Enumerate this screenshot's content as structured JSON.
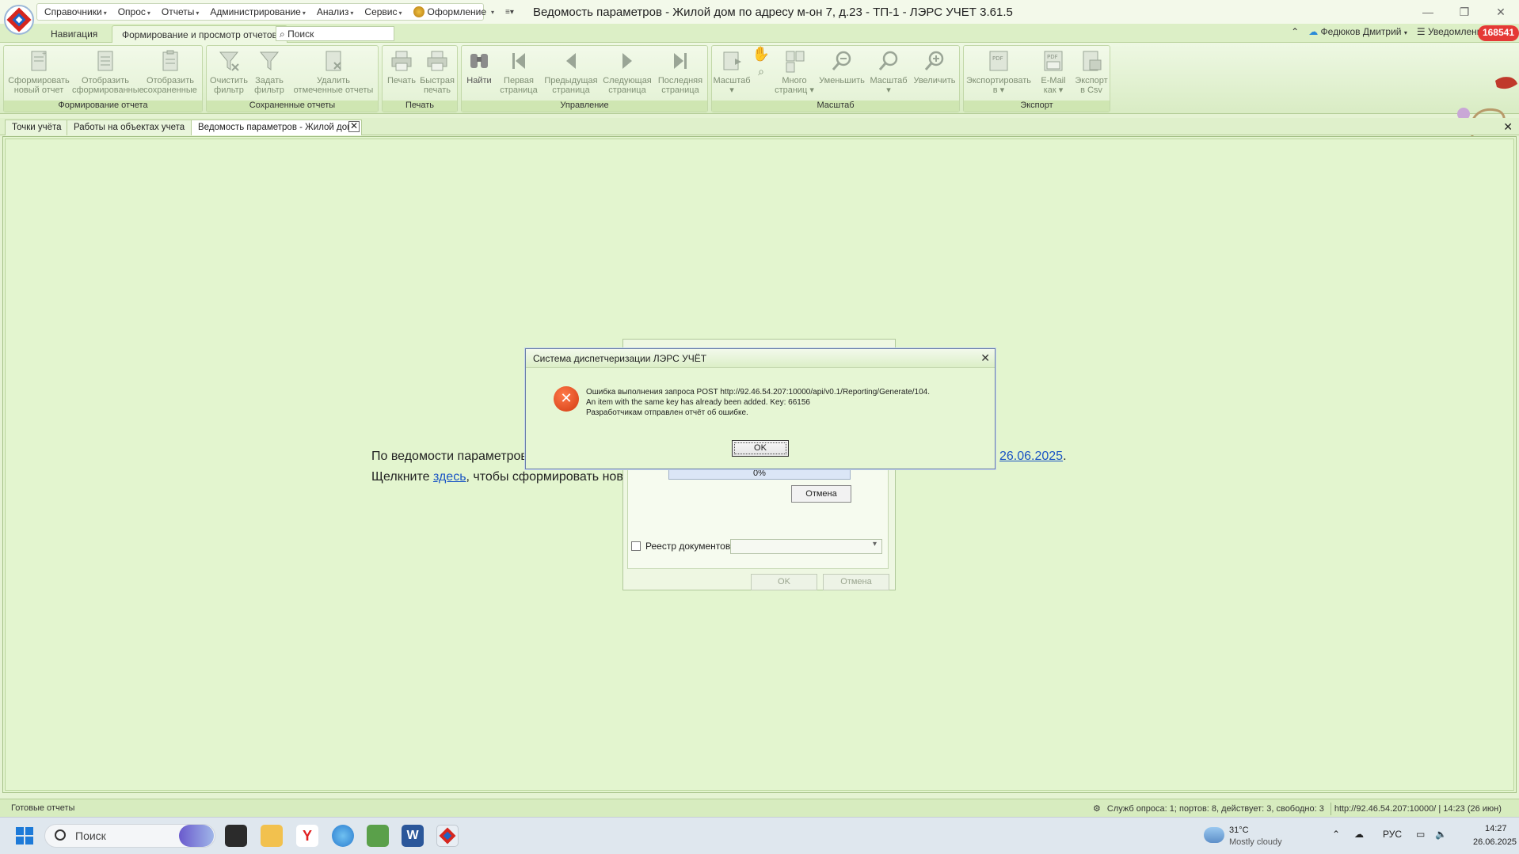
{
  "window": {
    "title": "Ведомость параметров -  Жилой дом по адресу м-он 7, д.23   - ТП-1 - ЛЭРС УЧЕТ 3.61.5"
  },
  "menu": {
    "items": [
      "Справочники",
      "Опрос",
      "Отчеты",
      "Администрирование",
      "Анализ",
      "Сервис",
      "Оформление"
    ]
  },
  "ribbon_tabs": {
    "navigation": "Навигация",
    "reports": "Формирование и просмотр отчетов",
    "search_placeholder": "Поиск"
  },
  "user": {
    "name": "Федюков Дмитрий",
    "notifications_label": "Уведомления",
    "notifications_count": "168541"
  },
  "ribbon": {
    "groups": {
      "report": "Формирование отчета",
      "saved": "Сохраненные отчеты",
      "print": "Печать",
      "control": "Управление",
      "scale": "Масштаб",
      "export": "Экспорт"
    },
    "buttons": {
      "new_report": [
        "Сформировать",
        "новый отчет"
      ],
      "show_generated": [
        "Отобразить",
        "сформированные"
      ],
      "show_saved": [
        "Отобразить",
        "сохраненные"
      ],
      "clear_filter": [
        "Очистить",
        "фильтр"
      ],
      "set_filter": [
        "Задать",
        "фильтр"
      ],
      "delete_marked": [
        "Удалить",
        "отмеченные отчеты"
      ],
      "print": [
        "Печать",
        ""
      ],
      "quick_print": [
        "Быстрая",
        "печать"
      ],
      "find": [
        "Найти",
        ""
      ],
      "first_page": [
        "Первая",
        "страница"
      ],
      "prev_page": [
        "Предыдущая",
        "страница"
      ],
      "next_page": [
        "Следующая",
        "страница"
      ],
      "last_page": [
        "Последняя",
        "страница"
      ],
      "scale_menu": [
        "Масштаб",
        ""
      ],
      "multi_page": [
        "Много",
        "страниц"
      ],
      "zoom_out": [
        "Уменьшить",
        ""
      ],
      "scale": [
        "Масштаб",
        ""
      ],
      "zoom_in": [
        "Увеличить",
        ""
      ],
      "export_to": [
        "Экспортировать",
        "в"
      ],
      "email_as": [
        "E-Mail",
        "как"
      ],
      "export_csv": [
        "Экспорт",
        "в Csv"
      ]
    }
  },
  "doc_tabs": {
    "items": [
      "Точки учёта",
      "Работы на объектах учета",
      "Ведомость параметров - Жилой дом"
    ]
  },
  "main": {
    "line1_prefix": "По ведомости параметров",
    "line1_date": "26.06.2025",
    "line1_suffix": ".",
    "line2_prefix": "Щелкните ",
    "line2_link": "здесь",
    "line2_suffix": ", чтобы сформировать нов"
  },
  "bg_dialog": {
    "progress_text": "0%",
    "progress_value": 0,
    "cancel_inner": "Отмена",
    "reestr_label": "Реестр документов",
    "ok": "OK",
    "cancel": "Отмена"
  },
  "error_dialog": {
    "title": "Система диспетчеризации ЛЭРС УЧЁТ",
    "line1": "Ошибка выполнения запроса POST http://92.46.54.207:10000/api/v0.1/Reporting/Generate/104.",
    "line2": "An item with the same key has already been added. Key: 66156",
    "line3": "Разработчикам отправлен отчёт об ошибке.",
    "ok": "OK"
  },
  "statusbar": {
    "left": "Готовые отчеты",
    "services": "Служб опроса: 1; портов: 8, действует: 3, свободно: 3",
    "server": "http://92.46.54.207:10000/ | 14:23 (26 июн)"
  },
  "taskbar": {
    "search": "Поиск",
    "weather_temp": "31°C",
    "weather_desc": "Mostly cloudy",
    "lang": "РУС",
    "time": "14:27",
    "date": "26.06.2025"
  },
  "colors": {
    "accent_green": "#dcefc6",
    "badge_red": "#e53935",
    "link_blue": "#1a55c4",
    "error_red": "#d23b12"
  }
}
